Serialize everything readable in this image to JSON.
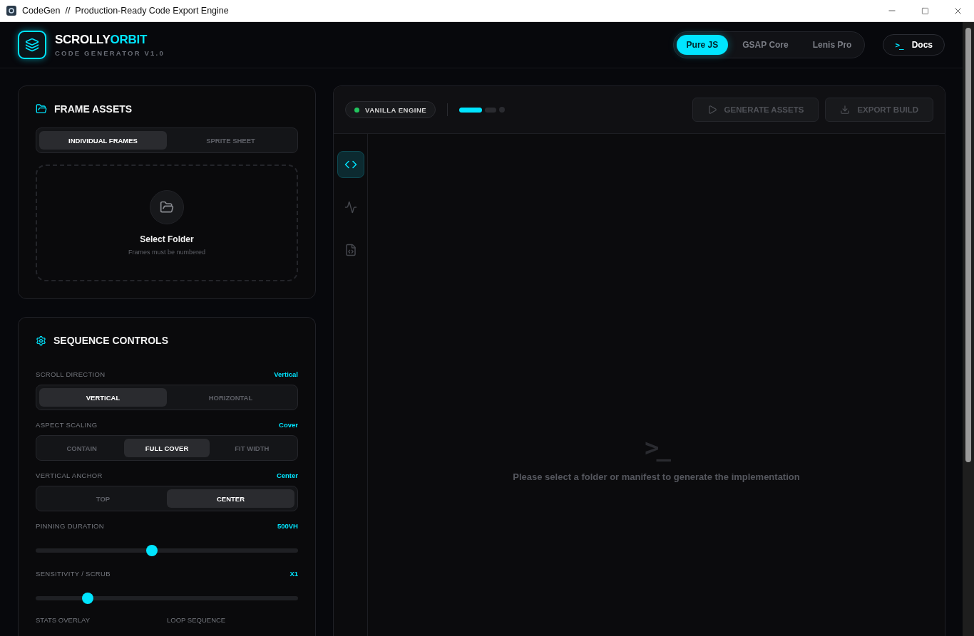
{
  "window": {
    "title": "CodeGen  //  Production-Ready Code Export Engine"
  },
  "header": {
    "brand_main": "SCROLLY",
    "brand_accent": "ORBIT",
    "subtitle": "CODE GENERATOR V1.0",
    "engines": [
      {
        "label": "Pure JS",
        "selected": true
      },
      {
        "label": "GSAP Core",
        "selected": false
      },
      {
        "label": "Lenis Pro",
        "selected": false
      }
    ],
    "docs_icon": ">_",
    "docs": "Docs"
  },
  "frame_assets": {
    "title": "FRAME ASSETS",
    "modes": [
      {
        "label": "INDIVIDUAL FRAMES",
        "selected": true
      },
      {
        "label": "SPRITE SHEET",
        "selected": false
      }
    ],
    "dropzone": {
      "title": "Select Folder",
      "hint": "Frames must be numbered"
    }
  },
  "sequence_controls": {
    "title": "SEQUENCE CONTROLS",
    "settings": [
      {
        "kind": "segmented",
        "label": "SCROLL DIRECTION",
        "value": "Vertical",
        "options": [
          {
            "label": "VERTICAL",
            "selected": true
          },
          {
            "label": "HORIZONTAL",
            "selected": false
          }
        ]
      },
      {
        "kind": "segmented",
        "label": "ASPECT SCALING",
        "value": "Cover",
        "options": [
          {
            "label": "CONTAIN",
            "selected": false
          },
          {
            "label": "FULL COVER",
            "selected": true
          },
          {
            "label": "FIT WIDTH",
            "selected": false
          }
        ]
      },
      {
        "kind": "segmented",
        "label": "VERTICAL ANCHOR",
        "value": "Center",
        "options": [
          {
            "label": "TOP",
            "selected": false
          },
          {
            "label": "CENTER",
            "selected": true
          }
        ]
      },
      {
        "kind": "slider",
        "label": "PINNING DURATION",
        "value": "500VH",
        "level": 0.443
      },
      {
        "kind": "slider",
        "label": "SENSITIVITY / SCRUB",
        "value": "X1",
        "level": 0.198
      }
    ],
    "bottom_labels": [
      "STATS OVERLAY",
      "LOOP SEQUENCE"
    ]
  },
  "output": {
    "engine_status": "VANILLA ENGINE",
    "engine_on": true,
    "steps": [
      {
        "selected": true
      },
      {
        "selected": false
      },
      {
        "selected": false
      }
    ],
    "actions": [
      {
        "kind": "play",
        "label": "GENERATE ASSETS",
        "disabled": true
      },
      {
        "kind": "download",
        "label": "EXPORT BUILD",
        "disabled": true
      }
    ],
    "tools": [
      {
        "kind": "code",
        "selected": true
      },
      {
        "kind": "activity",
        "selected": false
      },
      {
        "kind": "file",
        "selected": false
      }
    ],
    "empty_icon": ">_",
    "empty_message": "Please select a folder or manifest to generate the implementation"
  }
}
